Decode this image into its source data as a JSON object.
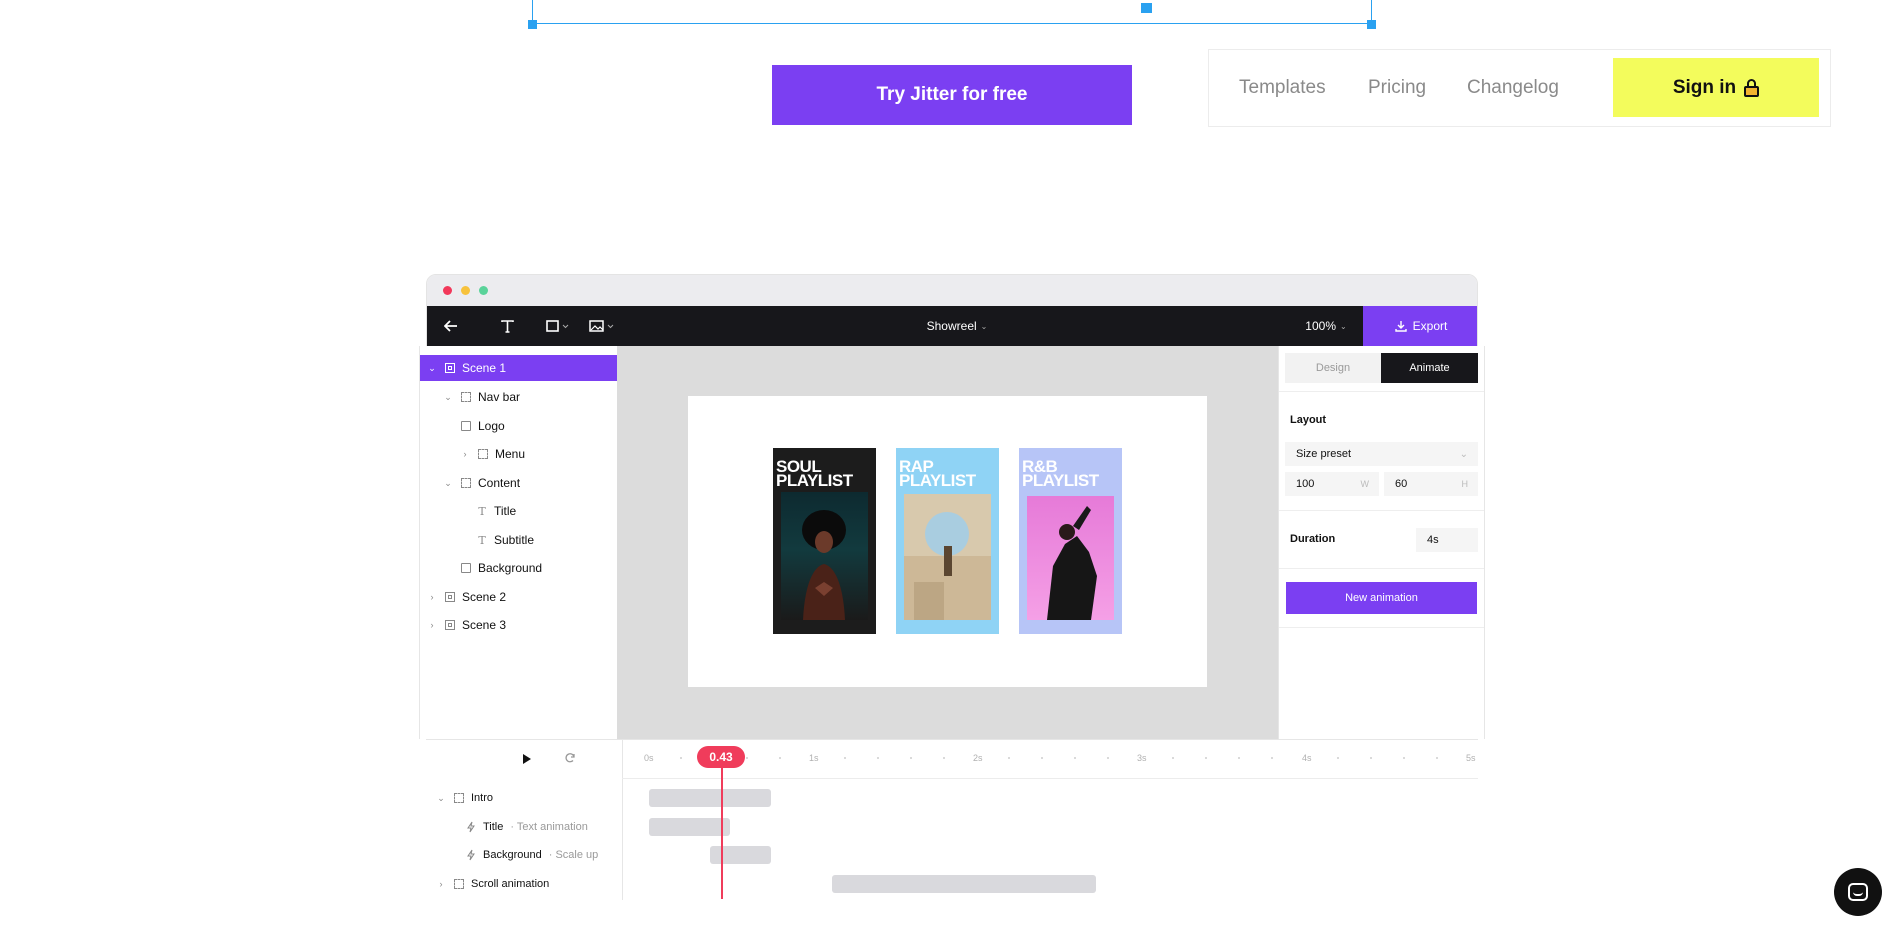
{
  "hero": {
    "cta_label": "Try Jitter for free"
  },
  "topnav": {
    "links": [
      "Templates",
      "Pricing",
      "Changelog"
    ],
    "signin_label": "Sign in",
    "signin_color": "#f3fc5c"
  },
  "colors": {
    "accent": "#7b3ff2",
    "playhead": "#f03c5b",
    "toolbar": "#17171b"
  },
  "editor": {
    "toolbar": {
      "back_icon": "arrow-left-icon",
      "tools": [
        "text-tool-icon",
        "shape-tool-icon",
        "image-tool-icon"
      ],
      "document_title": "Showreel",
      "zoom": "100%",
      "export_label": "Export"
    },
    "layers": [
      {
        "label": "Scene 1",
        "icon": "scene-icon",
        "expanded": true,
        "selected": true
      },
      {
        "label": "Nav bar",
        "icon": "frame-icon",
        "expanded": true
      },
      {
        "label": "Logo",
        "icon": "image-icon"
      },
      {
        "label": "Menu",
        "icon": "frame-icon",
        "expanded": false
      },
      {
        "label": "Content",
        "icon": "frame-icon",
        "expanded": true
      },
      {
        "label": "Title",
        "icon": "text-icon"
      },
      {
        "label": "Subtitle",
        "icon": "text-icon"
      },
      {
        "label": "Background",
        "icon": "image-icon"
      },
      {
        "label": "Scene 2",
        "icon": "scene-icon",
        "expanded": false
      },
      {
        "label": "Scene 3",
        "icon": "scene-icon",
        "expanded": false
      }
    ],
    "artboard": {
      "posters": [
        {
          "title": "SOUL PLAYLIST",
          "title_line1": "SOUL",
          "title_line2": "PLAYLIST",
          "bg": "#1c1c1c",
          "text_color": "#ffffff"
        },
        {
          "title": "RAP PLAYLIST",
          "title_line1": "RAP",
          "title_line2": "PLAYLIST",
          "bg": "#8fd3f5",
          "text_color": "#ffffff"
        },
        {
          "title": "R&B PLAYLIST",
          "title_line1": "R&B",
          "title_line2": "PLAYLIST",
          "bg": "#b7c5f7",
          "text_color": "#ffffff"
        }
      ]
    },
    "props": {
      "tabs": [
        "Design",
        "Animate"
      ],
      "active_tab": "Animate",
      "layout_label": "Layout",
      "size_preset": "Size preset",
      "width_value": "100",
      "width_suffix": "W",
      "height_value": "60",
      "height_suffix": "H",
      "duration_label": "Duration",
      "duration_value": "4s",
      "new_animation_label": "New animation"
    },
    "timeline": {
      "play_icon": "play-icon",
      "loop_icon": "loop-icon",
      "ticks": [
        "0s",
        "1s",
        "2s",
        "3s",
        "4s",
        "5s"
      ],
      "current_time": "0.43",
      "rows": [
        {
          "label": "Intro",
          "sub": "",
          "icon": "frame-icon"
        },
        {
          "label": "Title",
          "sub": "· Text animation",
          "icon": "lightning-icon"
        },
        {
          "label": "Background",
          "sub": "· Scale up",
          "icon": "lightning-icon"
        },
        {
          "label": "Scroll animation",
          "sub": "",
          "icon": "frame-icon"
        }
      ]
    }
  }
}
